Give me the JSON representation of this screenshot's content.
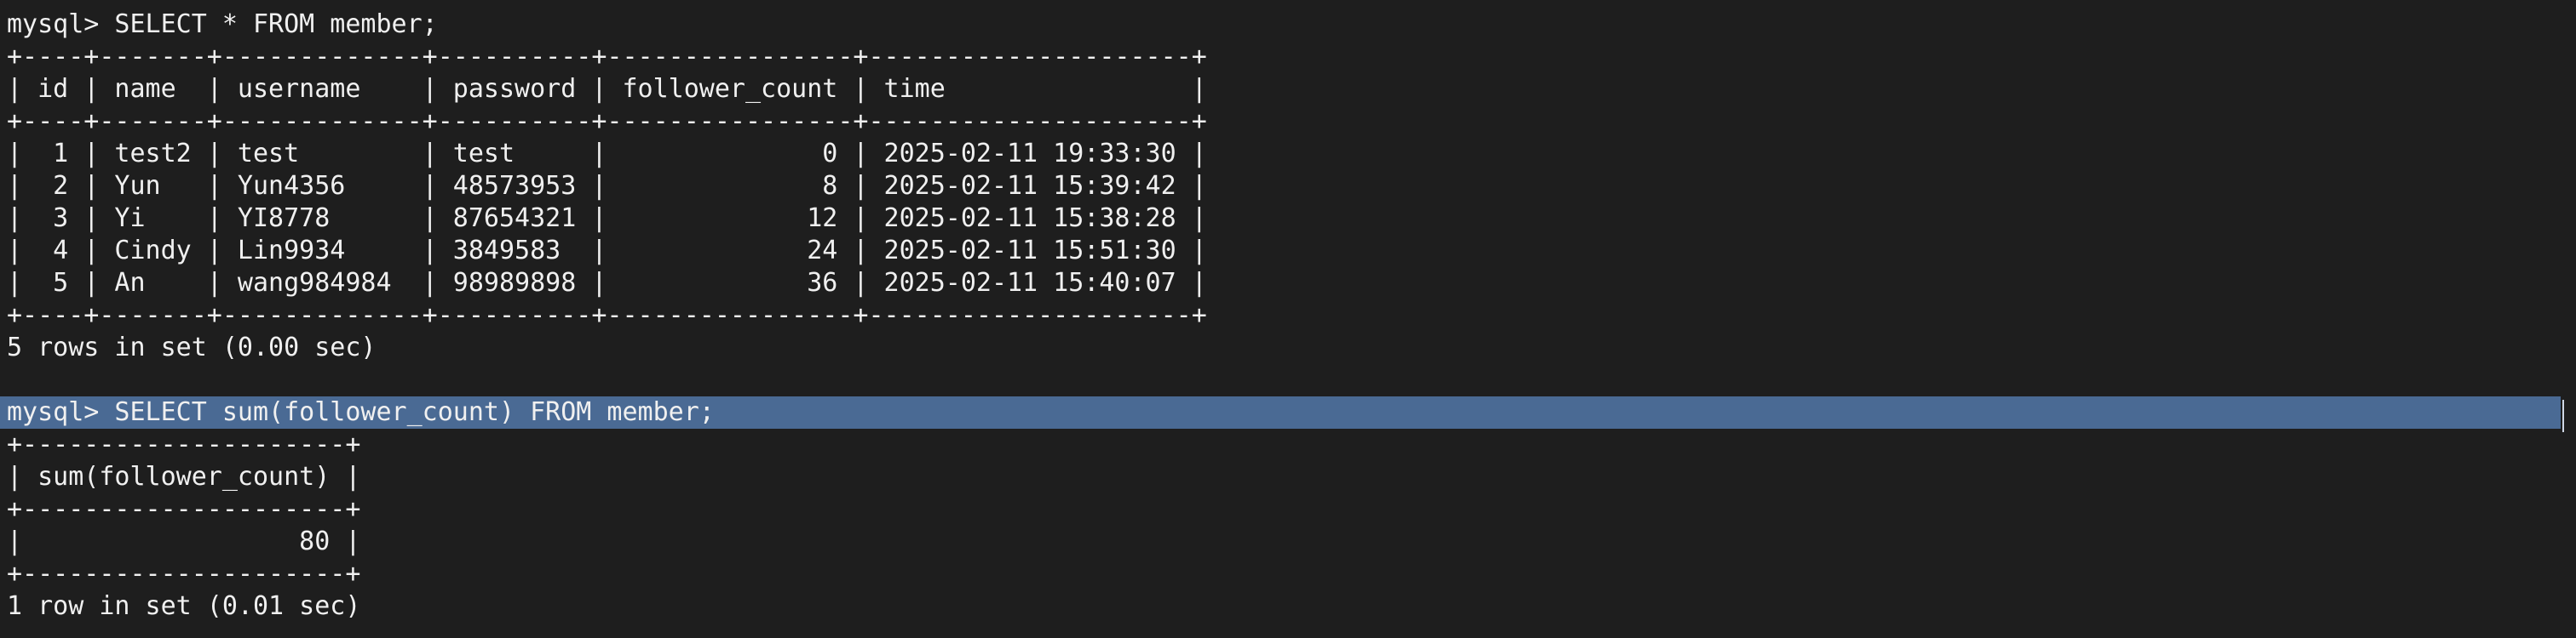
{
  "terminal": {
    "lines": [
      "mysql> SELECT * FROM member;",
      "+----+-------+-------------+----------+----------------+---------------------+",
      "| id | name  | username    | password | follower_count | time                |",
      "+----+-------+-------------+----------+----------------+---------------------+",
      "|  1 | test2 | test        | test     |              0 | 2025-02-11 19:33:30 |",
      "|  2 | Yun   | Yun4356     | 48573953 |              8 | 2025-02-11 15:39:42 |",
      "|  3 | Yi    | YI8778      | 87654321 |             12 | 2025-02-11 15:38:28 |",
      "|  4 | Cindy | Lin9934     | 3849583  |             24 | 2025-02-11 15:51:30 |",
      "|  5 | An    | wang984984  | 98989898 |             36 | 2025-02-11 15:40:07 |",
      "+----+-------+-------------+----------+----------------+---------------------+",
      "5 rows in set (0.00 sec)",
      "",
      "mysql> SELECT sum(follower_count) FROM member;",
      "+---------------------+",
      "| sum(follower_count) |",
      "+---------------------+",
      "|                  80 |",
      "+---------------------+",
      "1 row in set (0.01 sec)"
    ]
  }
}
